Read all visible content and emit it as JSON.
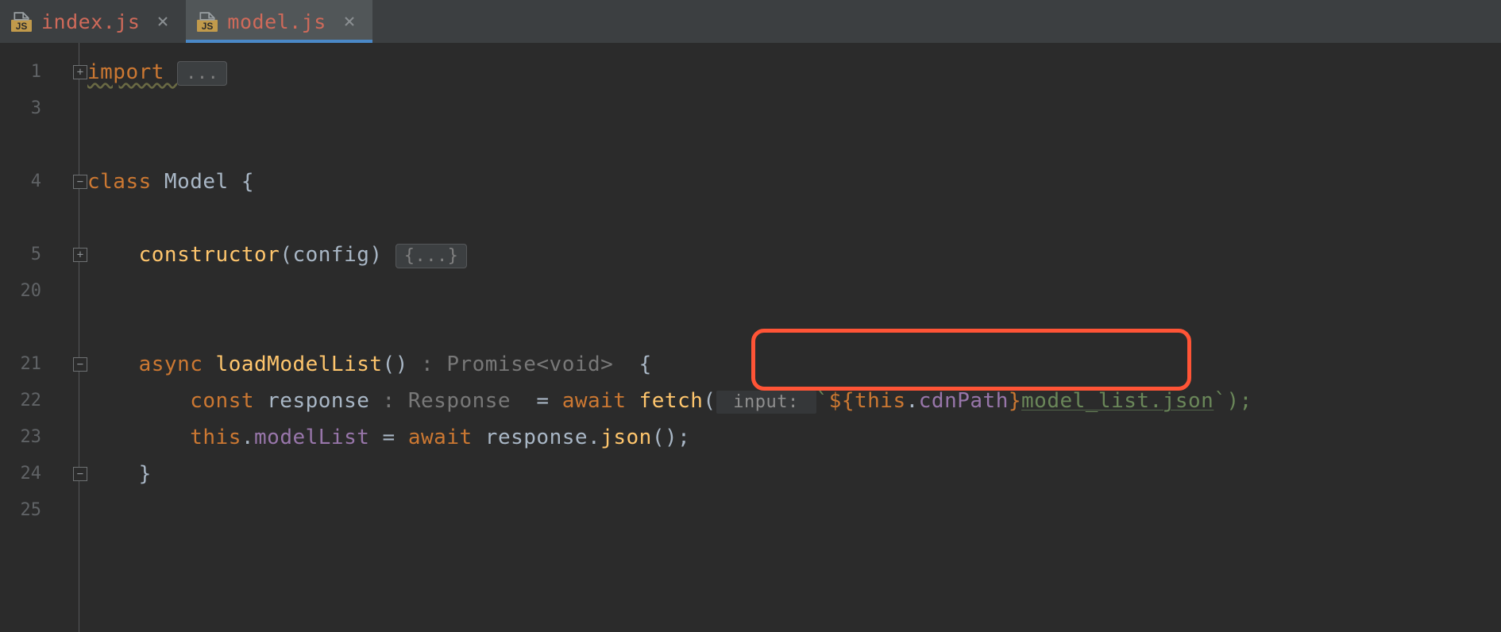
{
  "tabs": [
    {
      "label": "index.js",
      "active": false
    },
    {
      "label": "model.js",
      "active": true
    }
  ],
  "gutter": [
    "1",
    "3",
    "",
    "4",
    "",
    "5",
    "20",
    "",
    "21",
    "22",
    "23",
    "24",
    "25"
  ],
  "code": {
    "l1_import": "import ",
    "l1_fold": "...",
    "l4_class": "class ",
    "l4_name": "Model ",
    "l4_brace": "{",
    "l5_ctor": "constructor",
    "l5_params": "(config) ",
    "l5_fold": "{...}",
    "l21_async": "async ",
    "l21_fn": "loadModelList",
    "l21_params": "() ",
    "l21_hint": ": Promise<void>  ",
    "l21_brace": "{",
    "l22_const": "const ",
    "l22_resp": "response ",
    "l22_typehint": ": Response ",
    "l22_eq": " = ",
    "l22_await": "await ",
    "l22_fetch": "fetch",
    "l22_paren_open": "(",
    "l22_inputhint": " input: ",
    "l22_tick": "`",
    "l22_dollar_open": "${",
    "l22_this": "this",
    "l22_dot": ".",
    "l22_cdn": "cdnPath",
    "l22_close_brace": "}",
    "l22_path": "model_list.json",
    "l22_end": "`);",
    "l23_this": "this",
    "l23_dot": ".",
    "l23_ml": "modelList",
    "l23_eq": " = ",
    "l23_await": "await ",
    "l23_resp": "response.",
    "l23_json": "json",
    "l23_end": "();",
    "l24_brace": "}"
  },
  "icons": {
    "js_label": "JS"
  },
  "colors": {
    "keyword": "#cc7832",
    "function": "#ffc66d",
    "property": "#9876aa",
    "string": "#6a8759",
    "hint": "#787878",
    "highlight": "#ff5436"
  }
}
